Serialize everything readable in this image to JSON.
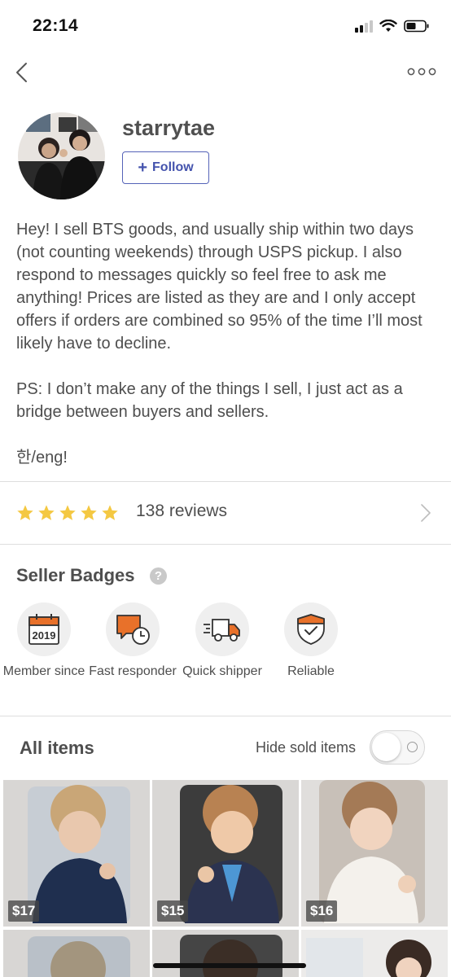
{
  "status_bar": {
    "time": "22:14"
  },
  "profile": {
    "username": "starrytae",
    "follow_label": "Follow",
    "bio_paragraphs": [
      "Hey! I sell BTS goods, and usually ship within two days (not counting weekends) through USPS pickup. I also respond to messages quickly so feel free to ask me anything! Prices are listed as they are and I only accept offers if orders are combined so 95% of the time I’ll most likely have to decline.",
      "PS: I don’t make any of the things I sell, I just act as a bridge between buyers and sellers.",
      "한/eng!"
    ]
  },
  "reviews": {
    "rating": 5,
    "label": "138 reviews",
    "star_color": "#f4c842"
  },
  "badges": {
    "title": "Seller Badges",
    "items": [
      {
        "label": "Member since",
        "icon": "calendar-2019-icon",
        "icon_text": "2019"
      },
      {
        "label": "Fast responder",
        "icon": "chat-clock-icon"
      },
      {
        "label": "Quick shipper",
        "icon": "truck-icon"
      },
      {
        "label": "Reliable",
        "icon": "shield-check-icon"
      }
    ],
    "accent_color": "#e8712a"
  },
  "items_section": {
    "title": "All items",
    "hide_sold_label": "Hide sold items",
    "hide_sold_on": false,
    "items": [
      {
        "price": "$17"
      },
      {
        "price": "$15"
      },
      {
        "price": "$16"
      },
      {
        "price": ""
      },
      {
        "price": ""
      },
      {
        "price": ""
      }
    ]
  },
  "colors": {
    "follow": "#4453ad",
    "text": "#4e4e4e"
  }
}
